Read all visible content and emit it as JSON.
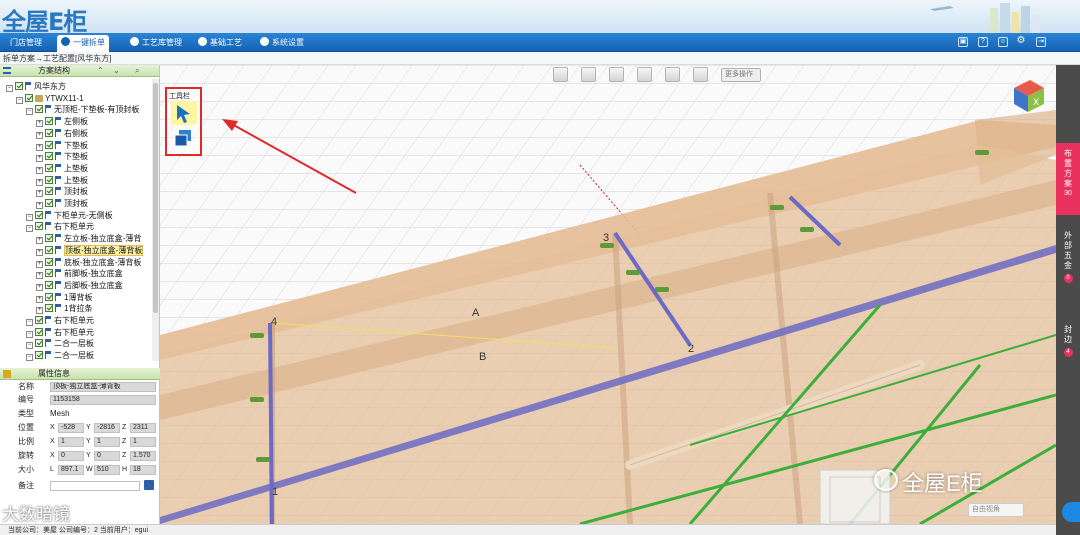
{
  "app": {
    "logo": "全屋E柜"
  },
  "nav": {
    "tabs": [
      {
        "label": "门店管理"
      },
      {
        "label": "一键拆单"
      },
      {
        "label": "工艺库管理"
      },
      {
        "label": "基础工艺"
      },
      {
        "label": "系统设置"
      }
    ]
  },
  "breadcrumb": "拆单方案→工艺配置[风华东方]",
  "scheme_panel": {
    "title": "方案结构"
  },
  "tree": [
    {
      "label": "风华东方"
    },
    {
      "label": "YTWX11-1"
    },
    {
      "label": "无顶柜-下垫板-有顶封板"
    },
    {
      "label": "左侧板"
    },
    {
      "label": "右侧板"
    },
    {
      "label": "下垫板"
    },
    {
      "label": "下垫板"
    },
    {
      "label": "上垫板"
    },
    {
      "label": "上垫板"
    },
    {
      "label": "顶封板"
    },
    {
      "label": "顶封板"
    },
    {
      "label": "下柜单元-无侧板"
    },
    {
      "label": "右下柜单元"
    },
    {
      "label": "左立板-独立底盒-薄背"
    },
    {
      "label": "顶板-独立底盒-薄背板"
    },
    {
      "label": "底板-独立底盒-薄背板"
    },
    {
      "label": "前脚板-独立底盒"
    },
    {
      "label": "后脚板-独立底盒"
    },
    {
      "label": "1薄背板"
    },
    {
      "label": "1背拉条"
    },
    {
      "label": "右下柜单元"
    },
    {
      "label": "右下柜单元"
    },
    {
      "label": "二合一层板"
    },
    {
      "label": "二合一层板"
    }
  ],
  "props": {
    "title": "属性信息",
    "name_label": "名称",
    "name_value": "顶板-独立底盒-薄背板",
    "code_label": "编号",
    "code_value": "1153158",
    "type_label": "类型",
    "type_value": "Mesh",
    "pos_label": "位置",
    "pos": {
      "x": "-528",
      "y": "-2816",
      "z": "2311"
    },
    "scale_label": "比例",
    "scale": {
      "x": "1",
      "y": "1",
      "z": "1"
    },
    "rot_label": "旋转",
    "rot": {
      "x": "0",
      "y": "0",
      "z": "1.570"
    },
    "size_label": "大小",
    "size": {
      "l": "897.1",
      "w": "510",
      "h": "18"
    },
    "note_label": "备注",
    "axis": {
      "x": "X",
      "y": "Y",
      "z": "Z",
      "l": "L",
      "w": "W",
      "h": "H"
    }
  },
  "viewport": {
    "more_ops": "更多操作",
    "toolbox_title": "工具栏",
    "camera_select": "自由视角",
    "labels": {
      "p1": "1",
      "p2": "2",
      "p3": "3",
      "p4": "4",
      "a": "A",
      "b": "B"
    }
  },
  "right_sidebar": [
    {
      "label": "布置方案",
      "count": "30"
    },
    {
      "label": "外部五金",
      "count": "0"
    },
    {
      "label": "封边",
      "count": "4"
    }
  ],
  "status": {
    "text": "当前公司：美屋   公司编号：2   当前用户：egui"
  },
  "watermarks": {
    "brand": "全屋E柜",
    "corner": "大数暗镜"
  },
  "colors": {
    "nav": "#1662b2",
    "accent": "#e8315f",
    "cabinet": "#e2bd95",
    "highlight": "#e02a2a"
  }
}
